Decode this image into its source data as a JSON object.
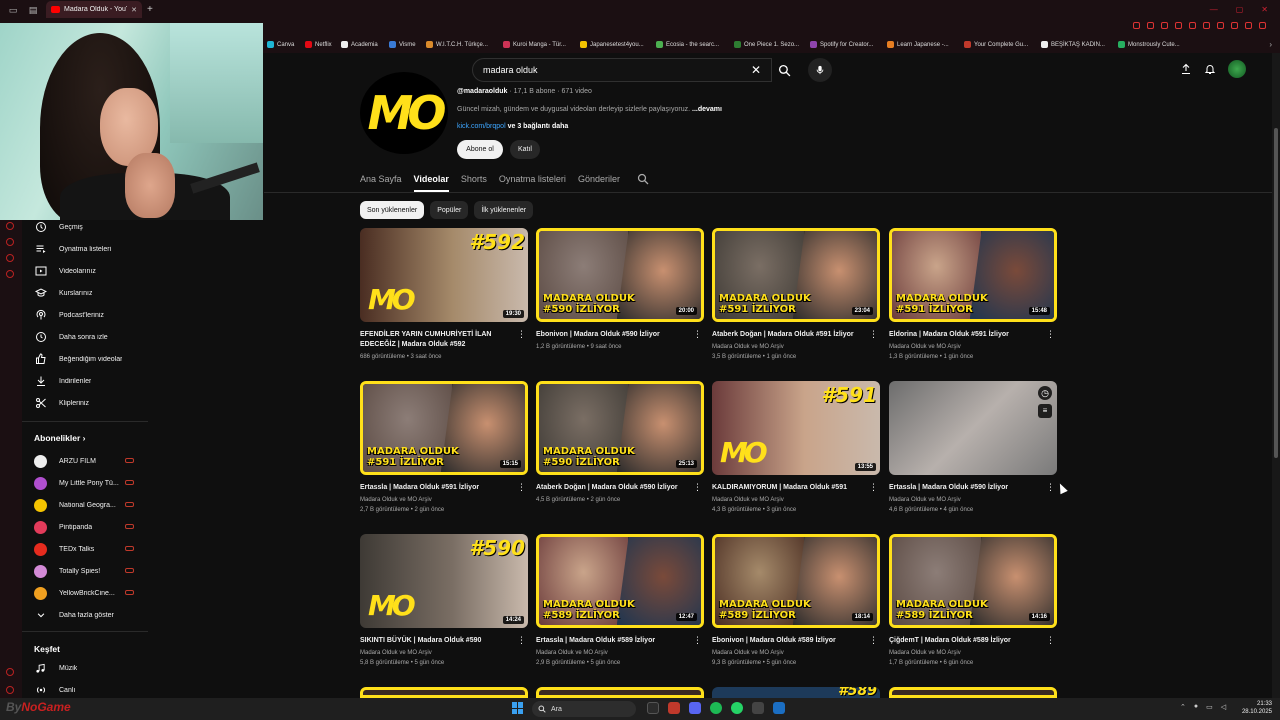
{
  "browser": {
    "tab_title": "Madara Olduk - YouTube",
    "bookmarks": [
      "Canva",
      "Netflix",
      "Academia",
      "Visme",
      "W.I.T.C.H. Türkçe...",
      "Kuroi Manga - Tür...",
      "Japanesetest4you...",
      "Ecosia - the searc...",
      "One Piece 1. Sezo...",
      "Spotify for Creator...",
      "Learn Japanese -...",
      "Your Complete Gu...",
      "BEŞİKTAŞ KADIN...",
      "Monstrously Cute..."
    ]
  },
  "search": {
    "query": "madara olduk"
  },
  "channel": {
    "handle": "@madaraolduk",
    "stats": " · 17,1 B abone · 671 video",
    "description": "Güncel mizah, gündem ve duygusal videoları derleyip sizlerle paylaşıyoruz.",
    "more": "...devamı",
    "link": "kick.com/brqpol",
    "link_more": "ve 3 bağlantı daha",
    "subscribe": "Abone ol",
    "join": "Katıl",
    "tabs": [
      "Ana Sayfa",
      "Videolar",
      "Shorts",
      "Oynatma listeleri",
      "Gönderiler"
    ],
    "active_tab": "Videolar",
    "chips": [
      "Son yüklenenler",
      "Popüler",
      "İlk yüklenenler"
    ]
  },
  "sidebar": {
    "items": [
      "Geçmiş",
      "Oynatma listeleri",
      "Videolarınız",
      "Kurslarınız",
      "Podcast'leriniz",
      "Daha sonra izle",
      "Beğendiğim videolar",
      "İndirilenler",
      "Klipleriniz"
    ],
    "subs_heading": "Abonelikler",
    "subs": [
      "ARZU FİLM",
      "My Little Pony Tü...",
      "National Geogra...",
      "Pintipanda",
      "TEDx Talks",
      "Totally Spies!",
      "YellowBrickCine..."
    ],
    "show_more": "Daha fazla göster",
    "explore_heading": "Keşfet",
    "explore": [
      "Müzik",
      "Canlı"
    ]
  },
  "videos": [
    {
      "title": "EFENDİLER YARIN CUMHURİYETİ İLAN EDECEĞİZ | Madara Olduk #592",
      "channel": "",
      "meta": "686 görüntüleme • 3 saat önce",
      "dur": "19:30",
      "ep": "#592",
      "overlay": "",
      "style": "mo"
    },
    {
      "title": "Ebonivon | Madara Olduk #590 İzliyor",
      "channel": "",
      "meta": "1,2 B görüntüleme • 9 saat önce",
      "dur": "20:00",
      "ep": "",
      "overlay": "MADARA OLDUK|#590 İZLİYOR",
      "style": "split"
    },
    {
      "title": "Ataberk Doğan | Madara Olduk #591 İzliyor",
      "channel": "Madara Olduk ve MO Arşiv",
      "meta": "3,5 B görüntüleme • 1 gün önce",
      "dur": "23:04",
      "ep": "",
      "overlay": "MADARA OLDUK|#591 İZLİYOR",
      "style": "split"
    },
    {
      "title": "Eldorina | Madara Olduk #591 İzliyor",
      "channel": "Madara Olduk ve MO Arşiv",
      "meta": "1,3 B görüntüleme • 1 gün önce",
      "dur": "15:48",
      "ep": "",
      "overlay": "MADARA OLDUK|#591 İZLİYOR",
      "style": "split"
    },
    {
      "title": "Ertassla | Madara Olduk #591 İzliyor",
      "channel": "Madara Olduk ve MO Arşiv",
      "meta": "2,7 B görüntüleme • 2 gün önce",
      "dur": "15:15",
      "ep": "",
      "overlay": "MADARA OLDUK|#591 İZLİYOR",
      "style": "split"
    },
    {
      "title": "Ataberk Doğan | Madara Olduk #590 İzliyor",
      "channel": "",
      "meta": "4,5 B görüntüleme • 2 gün önce",
      "dur": "25:13",
      "ep": "",
      "overlay": "MADARA OLDUK|#590 İZLİYOR",
      "style": "split"
    },
    {
      "title": "KALDIRAMIYORUM | Madara Olduk #591",
      "channel": "Madara Olduk ve MO Arşiv",
      "meta": "4,3 B görüntüleme • 3 gün önce",
      "dur": "13:55",
      "ep": "#591",
      "overlay": "",
      "style": "mo"
    },
    {
      "title": "Ertassla | Madara Olduk #590 İzliyor",
      "channel": "Madara Olduk ve MO Arşiv",
      "meta": "4,6 B görüntüleme • 4 gün önce",
      "dur": "",
      "ep": "",
      "overlay": "",
      "style": "blur"
    },
    {
      "title": "SIKINTI BÜYÜK | Madara Olduk #590",
      "channel": "Madara Olduk ve MO Arşiv",
      "meta": "5,8 B görüntüleme • 5 gün önce",
      "dur": "14:24",
      "ep": "#590",
      "overlay": "",
      "style": "mo"
    },
    {
      "title": "Ertassla | Madara Olduk #589 İzliyor",
      "channel": "Madara Olduk ve MO Arşiv",
      "meta": "2,9 B görüntüleme • 5 gün önce",
      "dur": "12:47",
      "ep": "",
      "overlay": "MADARA OLDUK|#589 İZLİYOR",
      "style": "split"
    },
    {
      "title": "Ebonivon | Madara Olduk #589 İzliyor",
      "channel": "Madara Olduk ve MO Arşiv",
      "meta": "9,3 B görüntüleme • 5 gün önce",
      "dur": "18:14",
      "ep": "",
      "overlay": "MADARA OLDUK|#589 İZLİYOR",
      "style": "split"
    },
    {
      "title": "ÇiğdemT | Madara Olduk #589 İzliyor",
      "channel": "Madara Olduk ve MO Arşiv",
      "meta": "1,7 B görüntüleme • 6 gün önce",
      "dur": "14:16",
      "ep": "",
      "overlay": "MADARA OLDUK|#589 İZLİYOR",
      "style": "split"
    }
  ],
  "partial_row_ep": "#589",
  "taskbar": {
    "search": "Ara",
    "time": "21:33",
    "date": "28.10.2025"
  },
  "watermark": {
    "prefix": "By",
    "brand": "NoGame"
  },
  "colors": {
    "accent_yellow": "#ffe01a",
    "yt_red": "#ff0000",
    "link_blue": "#3ea6ff",
    "bg": "#0f0f0f"
  }
}
